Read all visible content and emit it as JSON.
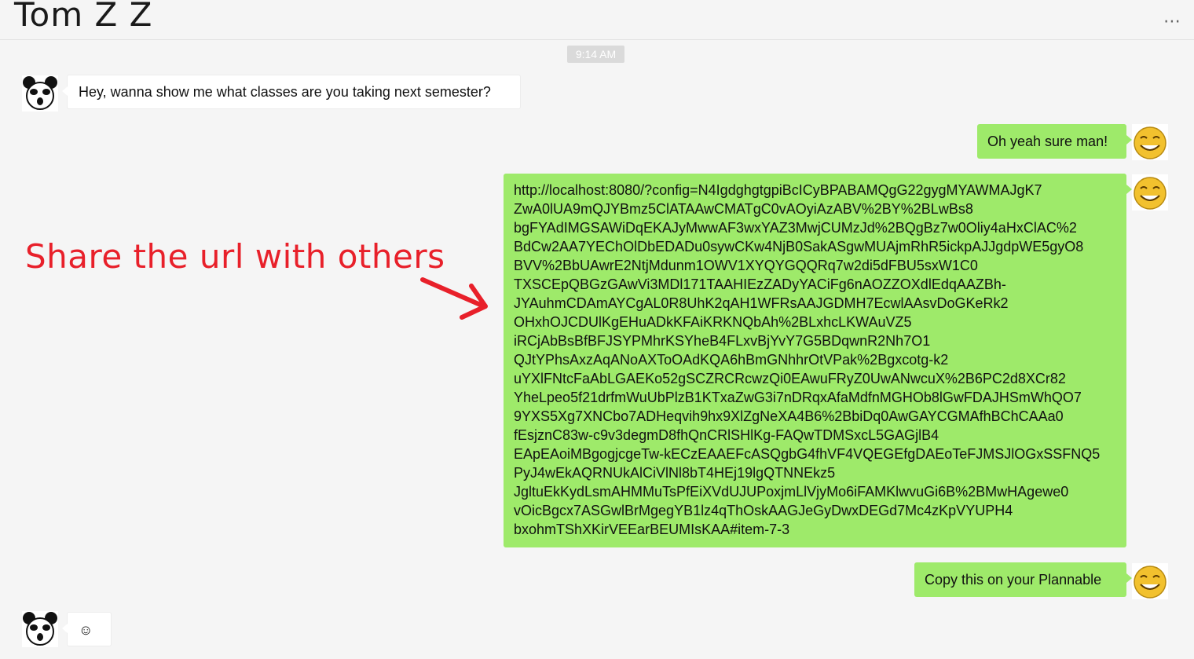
{
  "header": {
    "title": "Tom Z Z",
    "more_icon": "more-horizontal-icon",
    "more_glyph": "⋯"
  },
  "timestamp": "9:14 AM",
  "messages": [
    {
      "from": "contact",
      "avatar": "panda-avatar-icon",
      "text": "Hey, wanna show me what classes are you taking next semester?"
    },
    {
      "from": "me",
      "avatar": "smiley-avatar-icon",
      "text": "Oh yeah sure man!"
    },
    {
      "from": "me",
      "avatar": "smiley-avatar-icon",
      "text": "http://localhost:8080/?config=N4IgdghgtgpiBcICyBPABAMQgG22gygMYAWMAJgK7\nZwA0lUA9mQJYBmz5ClATAAwCMATgC0vAOyiAzABV%2BY%2BLwBs8\nbgFYAdIMGSAWiDqEKAJyMwwAF3wxYAZ3MwjCUMzJd%2BQgBz7w0Oliy4aHxClAC%2\nBdCw2AA7YEChOlDbEDADu0sywCKw4NjB0SakASgwMUAjmRhR5ickpAJJgdpWE5gyO8\nBVV%2BbUAwrE2NtjMdunm1OWV1XYQYGQQRq7w2di5dFBU5sxW1C0\nTXSCEpQBGzGAwVi3MDl171TAAHIEzZADyYACiFg6nAOZZOXdlEdqAAZBh-\nJYAuhmCDAmAYCgAL0R8UhK2qAH1WFRsAAJGDMH7EcwlAAsvDoGKeRk2\nOHxhOJCDUlKgEHuADkKFAiKRKNQbAh%2BLxhcLKWAuVZ5\niRCjAbBsBfBFJSYPMhrKSYheB4FLxvBjYvY7G5BDqwnR2Nh7O1\nQJtYPhsAxzAqANoAXToOAdKQA6hBmGNhhrOtVPak%2Bgxcotg-k2\nuYXlFNtcFaAbLGAEKo52gSCZRCRcwzQi0EAwuFRyZ0UwANwcuX%2B6PC2d8XCr82\nYheLpeo5f21drfmWuUbPlzB1KTxaZwG3i7nDRqxAfaMdfnMGHOb8lGwFDAJHSmWhQO7\n9YXS5Xg7XNCbo7ADHeqvih9hx9XlZgNeXA4B6%2BbiDq0AwGAYCGMAfhBChCAAa0\nfEsjznC83w-c9v3degmD8fhQnCRlSHlKg-FAQwTDMSxcL5GAGjlB4\nEApEAoiMBgogjcgeTw-kECzEAAEFcASQgbG4fhVF4VQEGEfgDAEoTeFJMSJlOGxSSFNQ5\nPyJ4wEkAQRNUkAlCiVlNl8bT4HEj19lgQTNNEkz5\nJgltuEkKydLsmAHMMuTsPfEiXVdUJUPoxjmLlVjyMo6iFAMKlwvuGi6B%2BMwHAgewe0\nvOicBgcx7ASGwlBrMgegYB1lz4qThOskAAGJeGyDwxDEGd7Mc4zKpVYUPH4\nbxohmTShXKirVEEarBEUMIsKAA#item-7-3"
    },
    {
      "from": "me",
      "avatar": "smiley-avatar-icon",
      "text": "Copy this on your Plannable"
    },
    {
      "from": "contact",
      "avatar": "panda-avatar-icon",
      "text": "☺"
    }
  ],
  "annotation": {
    "text": "Share the url with others",
    "color": "#e8202a",
    "arrow_icon": "red-arrow-icon"
  },
  "colors": {
    "outgoing_bubble": "#9eea6a",
    "incoming_bubble": "#ffffff",
    "background": "#f5f5f5"
  }
}
